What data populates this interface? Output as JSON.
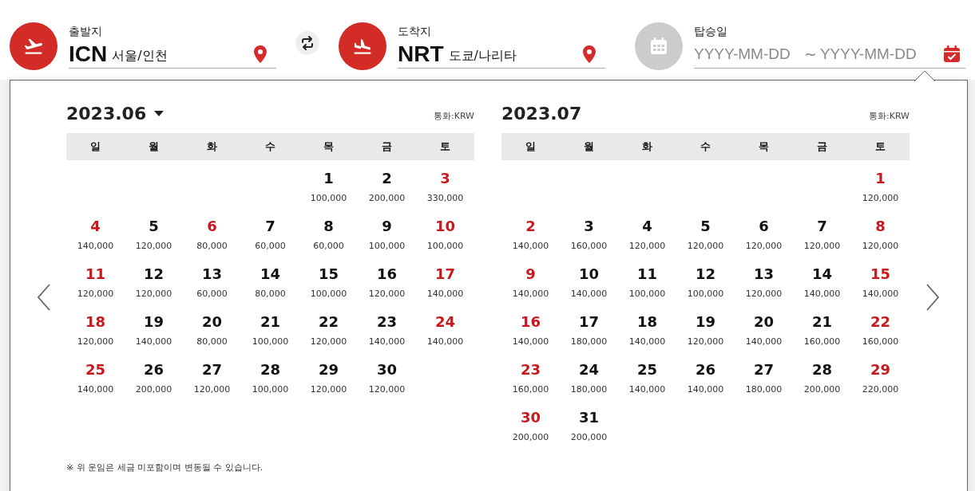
{
  "departure": {
    "label": "출발지",
    "code": "ICN",
    "city": "서울/인천"
  },
  "swap": {
    "kind": "swap"
  },
  "arrival": {
    "label": "도착지",
    "code": "NRT",
    "city": "도쿄/나리타"
  },
  "boarding": {
    "label": "탑승일",
    "start_placeholder": "YYYY-MM-DD",
    "separator": "~",
    "end_placeholder": "YYYY-MM-DD"
  },
  "months": [
    {
      "title": "2023.06",
      "dropdown": true,
      "currency": "통화:KRW",
      "weekdays": [
        "일",
        "월",
        "화",
        "수",
        "목",
        "금",
        "토"
      ],
      "weeks": [
        [
          {
            "kind": "blank"
          },
          {
            "kind": "blank"
          },
          {
            "kind": "blank"
          },
          {
            "kind": "blank"
          },
          {
            "kind": "day",
            "day": "1",
            "price": "100,000",
            "red": false
          },
          {
            "day": "2",
            "price": "200,000",
            "red": false
          },
          {
            "day": "3",
            "price": "330,000",
            "red": true
          }
        ],
        [
          {
            "day": "4",
            "price": "140,000",
            "red": true
          },
          {
            "day": "5",
            "price": "120,000",
            "red": false
          },
          {
            "day": "6",
            "price": "80,000",
            "red": true
          },
          {
            "day": "7",
            "price": "60,000",
            "red": false
          },
          {
            "day": "8",
            "price": "60,000",
            "red": false
          },
          {
            "day": "9",
            "price": "100,000",
            "red": false
          },
          {
            "day": "10",
            "price": "100,000",
            "red": true
          }
        ],
        [
          {
            "day": "11",
            "price": "120,000",
            "red": true
          },
          {
            "day": "12",
            "price": "120,000",
            "red": false
          },
          {
            "day": "13",
            "price": "60,000",
            "red": false
          },
          {
            "day": "14",
            "price": "80,000",
            "red": false
          },
          {
            "day": "15",
            "price": "100,000",
            "red": false
          },
          {
            "day": "16",
            "price": "120,000",
            "red": false
          },
          {
            "day": "17",
            "price": "140,000",
            "red": true
          }
        ],
        [
          {
            "day": "18",
            "price": "120,000",
            "red": true
          },
          {
            "day": "19",
            "price": "140,000",
            "red": false
          },
          {
            "day": "20",
            "price": "80,000",
            "red": false
          },
          {
            "day": "21",
            "price": "100,000",
            "red": false
          },
          {
            "day": "22",
            "price": "120,000",
            "red": false
          },
          {
            "day": "23",
            "price": "140,000",
            "red": false
          },
          {
            "day": "24",
            "price": "140,000",
            "red": true
          }
        ],
        [
          {
            "day": "25",
            "price": "140,000",
            "red": true
          },
          {
            "day": "26",
            "price": "200,000",
            "red": false
          },
          {
            "day": "27",
            "price": "120,000",
            "red": false
          },
          {
            "day": "28",
            "price": "100,000",
            "red": false
          },
          {
            "day": "29",
            "price": "120,000",
            "red": false
          },
          {
            "day": "30",
            "price": "120,000",
            "red": false
          },
          {
            "kind": "blank"
          }
        ]
      ]
    },
    {
      "title": "2023.07",
      "dropdown": false,
      "currency": "통화:KRW",
      "weekdays": [
        "일",
        "월",
        "화",
        "수",
        "목",
        "금",
        "토"
      ],
      "weeks": [
        [
          {
            "kind": "blank"
          },
          {
            "kind": "blank"
          },
          {
            "kind": "blank"
          },
          {
            "kind": "blank"
          },
          {
            "kind": "blank"
          },
          {
            "kind": "blank"
          },
          {
            "kind": "day",
            "day": "1",
            "price": "120,000",
            "red": true
          }
        ],
        [
          {
            "day": "2",
            "price": "140,000",
            "red": true
          },
          {
            "day": "3",
            "price": "160,000",
            "red": false
          },
          {
            "day": "4",
            "price": "120,000",
            "red": false
          },
          {
            "day": "5",
            "price": "120,000",
            "red": false
          },
          {
            "day": "6",
            "price": "120,000",
            "red": false
          },
          {
            "day": "7",
            "price": "120,000",
            "red": false
          },
          {
            "day": "8",
            "price": "120,000",
            "red": true
          }
        ],
        [
          {
            "day": "9",
            "price": "140,000",
            "red": true
          },
          {
            "day": "10",
            "price": "140,000",
            "red": false
          },
          {
            "day": "11",
            "price": "100,000",
            "red": false
          },
          {
            "day": "12",
            "price": "100,000",
            "red": false
          },
          {
            "day": "13",
            "price": "120,000",
            "red": false
          },
          {
            "day": "14",
            "price": "140,000",
            "red": false
          },
          {
            "day": "15",
            "price": "140,000",
            "red": true
          }
        ],
        [
          {
            "day": "16",
            "price": "140,000",
            "red": true
          },
          {
            "day": "17",
            "price": "180,000",
            "red": false
          },
          {
            "day": "18",
            "price": "140,000",
            "red": false
          },
          {
            "day": "19",
            "price": "120,000",
            "red": false
          },
          {
            "day": "20",
            "price": "140,000",
            "red": false
          },
          {
            "day": "21",
            "price": "160,000",
            "red": false
          },
          {
            "day": "22",
            "price": "160,000",
            "red": true
          }
        ],
        [
          {
            "day": "23",
            "price": "160,000",
            "red": true
          },
          {
            "day": "24",
            "price": "180,000",
            "red": false
          },
          {
            "day": "25",
            "price": "140,000",
            "red": false
          },
          {
            "day": "26",
            "price": "140,000",
            "red": false
          },
          {
            "day": "27",
            "price": "180,000",
            "red": false
          },
          {
            "day": "28",
            "price": "200,000",
            "red": false
          },
          {
            "day": "29",
            "price": "220,000",
            "red": true
          }
        ],
        [
          {
            "day": "30",
            "price": "200,000",
            "red": true
          },
          {
            "day": "31",
            "price": "200,000",
            "red": false
          },
          {
            "kind": "blank"
          },
          {
            "kind": "blank"
          },
          {
            "kind": "blank"
          },
          {
            "kind": "blank"
          },
          {
            "kind": "blank"
          }
        ]
      ]
    }
  ],
  "note": "※ 위 운임은 세금 미포함이며 변동될 수 있습니다."
}
